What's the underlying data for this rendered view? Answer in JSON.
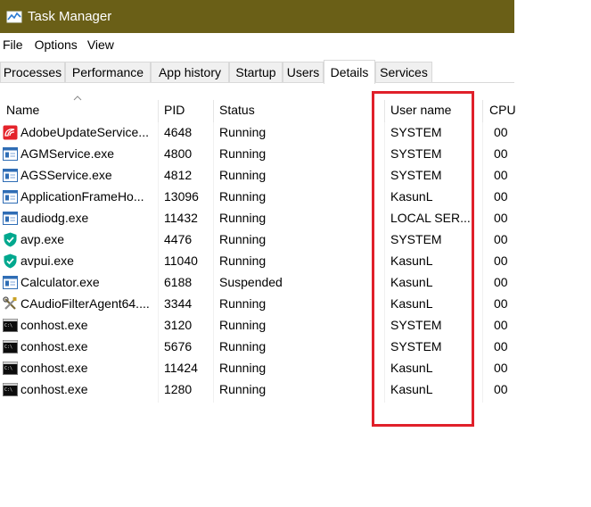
{
  "window": {
    "title": "Task Manager"
  },
  "menu": [
    "File",
    "Options",
    "View"
  ],
  "tabs": [
    "Processes",
    "Performance",
    "App history",
    "Startup",
    "Users",
    "Details",
    "Services"
  ],
  "active_tab": "Details",
  "columns": {
    "name": "Name",
    "pid": "PID",
    "status": "Status",
    "user": "User name",
    "cpu": "CPU"
  },
  "sorted_column": "name",
  "rows": [
    {
      "name": "AdobeUpdateService...",
      "pid": "4648",
      "status": "Running",
      "user": "SYSTEM",
      "cpu": "00",
      "icon": "adobe-icon"
    },
    {
      "name": "AGMService.exe",
      "pid": "4800",
      "status": "Running",
      "user": "SYSTEM",
      "cpu": "00",
      "icon": "application-window-icon"
    },
    {
      "name": "AGSService.exe",
      "pid": "4812",
      "status": "Running",
      "user": "SYSTEM",
      "cpu": "00",
      "icon": "application-window-icon"
    },
    {
      "name": "ApplicationFrameHo...",
      "pid": "13096",
      "status": "Running",
      "user": "KasunL",
      "cpu": "00",
      "icon": "application-window-icon"
    },
    {
      "name": "audiodg.exe",
      "pid": "11432",
      "status": "Running",
      "user": "LOCAL SER...",
      "cpu": "00",
      "icon": "application-window-icon"
    },
    {
      "name": "avp.exe",
      "pid": "4476",
      "status": "Running",
      "user": "SYSTEM",
      "cpu": "00",
      "icon": "shield-check-icon"
    },
    {
      "name": "avpui.exe",
      "pid": "11040",
      "status": "Running",
      "user": "KasunL",
      "cpu": "00",
      "icon": "shield-check-icon"
    },
    {
      "name": "Calculator.exe",
      "pid": "6188",
      "status": "Suspended",
      "user": "KasunL",
      "cpu": "00",
      "icon": "application-window-icon"
    },
    {
      "name": "CAudioFilterAgent64....",
      "pid": "3344",
      "status": "Running",
      "user": "KasunL",
      "cpu": "00",
      "icon": "tools-icon"
    },
    {
      "name": "conhost.exe",
      "pid": "3120",
      "status": "Running",
      "user": "SYSTEM",
      "cpu": "00",
      "icon": "console-icon"
    },
    {
      "name": "conhost.exe",
      "pid": "5676",
      "status": "Running",
      "user": "SYSTEM",
      "cpu": "00",
      "icon": "console-icon"
    },
    {
      "name": "conhost.exe",
      "pid": "11424",
      "status": "Running",
      "user": "KasunL",
      "cpu": "00",
      "icon": "console-icon"
    },
    {
      "name": "conhost.exe",
      "pid": "1280",
      "status": "Running",
      "user": "KasunL",
      "cpu": "00",
      "icon": "console-icon"
    }
  ],
  "colors": {
    "titlebar": "#6a5f17",
    "highlight": "#e0202a",
    "tab_border": "#d9d9d9"
  }
}
